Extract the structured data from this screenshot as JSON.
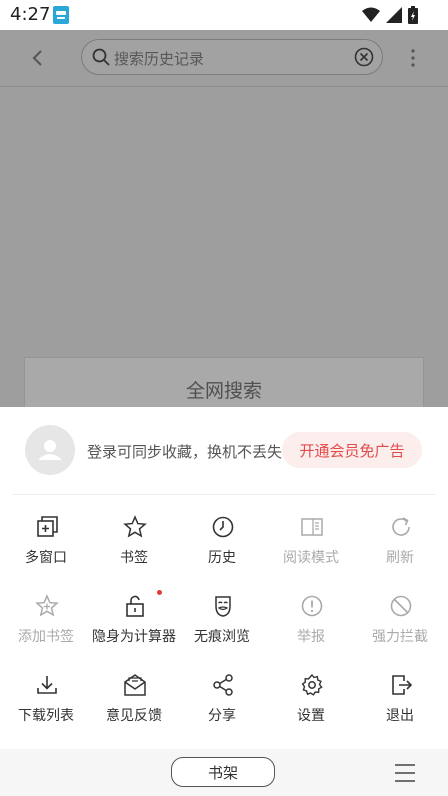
{
  "status": {
    "time": "4:27"
  },
  "header": {
    "search_placeholder": "搜索历史记录"
  },
  "background": {
    "card_title": "全网搜索"
  },
  "sheet": {
    "login_text": "登录可同步收藏，换机不丢失",
    "vip_label": "开通会员免广告",
    "rows": [
      [
        {
          "label": "多窗口",
          "icon": "multi-window-icon",
          "enabled": true
        },
        {
          "label": "书签",
          "icon": "star-icon",
          "enabled": true
        },
        {
          "label": "历史",
          "icon": "clock-icon",
          "enabled": true
        },
        {
          "label": "阅读模式",
          "icon": "book-icon",
          "enabled": false
        },
        {
          "label": "刷新",
          "icon": "refresh-icon",
          "enabled": false
        }
      ],
      [
        {
          "label": "添加书签",
          "icon": "star-add-icon",
          "enabled": false
        },
        {
          "label": "隐身为计算器",
          "icon": "lock-icon",
          "enabled": true
        },
        {
          "label": "无痕浏览",
          "icon": "mask-icon",
          "enabled": true
        },
        {
          "label": "举报",
          "icon": "alert-icon",
          "enabled": false
        },
        {
          "label": "强力拦截",
          "icon": "block-icon",
          "enabled": false
        }
      ],
      [
        {
          "label": "下载列表",
          "icon": "download-icon",
          "enabled": true
        },
        {
          "label": "意见反馈",
          "icon": "feedback-mail-icon",
          "enabled": true
        },
        {
          "label": "分享",
          "icon": "share-icon",
          "enabled": true
        },
        {
          "label": "设置",
          "icon": "gear-icon",
          "enabled": true
        },
        {
          "label": "退出",
          "icon": "exit-icon",
          "enabled": true
        }
      ]
    ]
  },
  "bottom": {
    "shelf_label": "书架"
  },
  "colors": {
    "accent": "#e34b4b",
    "disabled": "#aaaaaa",
    "text": "#333333"
  }
}
